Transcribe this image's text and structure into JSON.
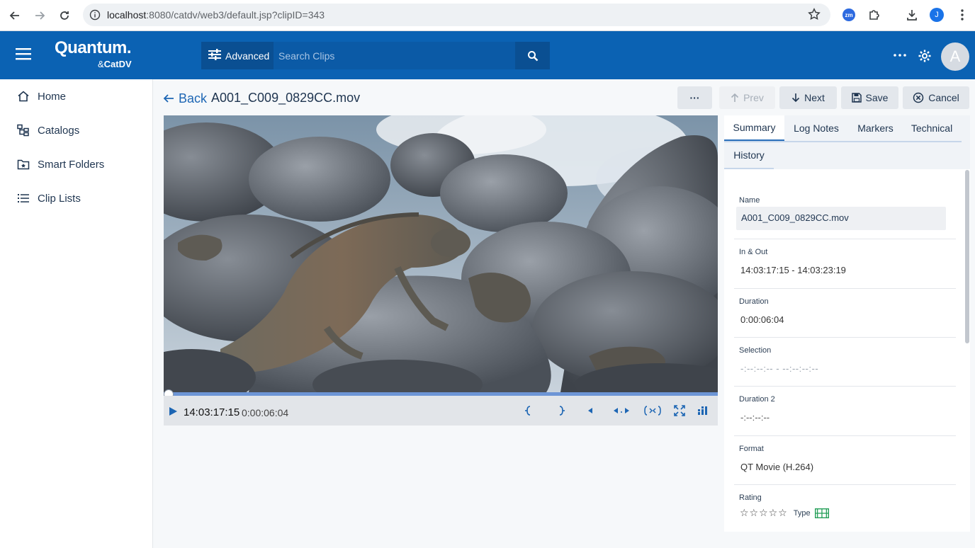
{
  "browser": {
    "url_host": "localhost",
    "url_path": ":8080/catdv/web3/default.jsp?clipID=343",
    "ext_zm": "zm",
    "profile_initial": "J"
  },
  "header": {
    "logo_brand": "Quantum.",
    "logo_product": "CatDV",
    "advanced_label": "Advanced",
    "search_placeholder": "Search Clips",
    "avatar_initial": "A"
  },
  "sidebar": {
    "items": [
      {
        "label": "Home",
        "icon": "home-icon"
      },
      {
        "label": "Catalogs",
        "icon": "catalogs-icon"
      },
      {
        "label": "Smart Folders",
        "icon": "smart-folder-icon"
      },
      {
        "label": "Clip Lists",
        "icon": "list-icon"
      }
    ]
  },
  "toolbar": {
    "back_label": "Back",
    "clip_title": "A001_C009_0829CC.mov",
    "more_label": "···",
    "prev_label": "Prev",
    "next_label": "Next",
    "save_label": "Save",
    "cancel_label": "Cancel"
  },
  "player": {
    "timecode": "14:03:17:15",
    "duration": "0:00:06:04",
    "progress": 0
  },
  "tabs": [
    "Summary",
    "Log Notes",
    "Markers",
    "Technical",
    "History"
  ],
  "fields": {
    "name": {
      "label": "Name",
      "value": "A001_C009_0829CC.mov"
    },
    "in_out": {
      "label": "In & Out",
      "value": "14:03:17:15 - 14:03:23:19"
    },
    "duration": {
      "label": "Duration",
      "value": "0:00:06:04"
    },
    "selection": {
      "label": "Selection",
      "value": "-:--:--:-- - --:--:--:--"
    },
    "duration2": {
      "label": "Duration 2",
      "value": "-:--:--:--"
    },
    "format": {
      "label": "Format",
      "value": "QT Movie (H.264)"
    },
    "rating": {
      "label": "Rating",
      "value": "☆☆☆☆☆",
      "type_label": "Type"
    }
  },
  "colors": {
    "header": "#0b62b3",
    "accent": "#1d66b4",
    "type_icon": "#27a05a"
  }
}
